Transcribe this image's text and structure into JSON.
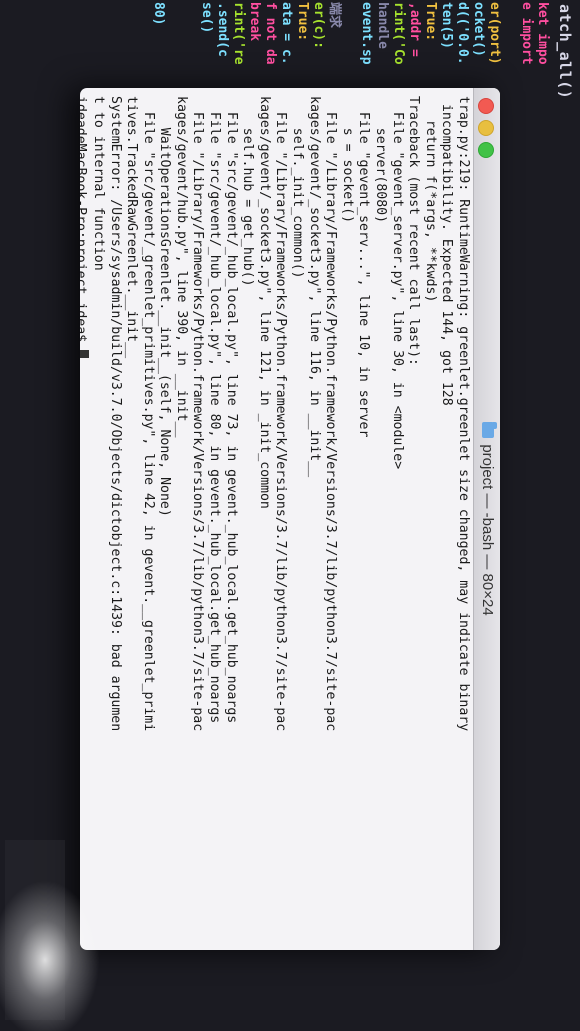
{
  "background_editor": {
    "top_text": "atch_all()",
    "lines": [
      {
        "text": "ket impo",
        "color": "#ff4fa0"
      },
      {
        "text": "e import",
        "color": "#ff4fa0"
      },
      {
        "text": "",
        "color": "#ffffff"
      },
      {
        "text": "er(port)",
        "color": "#f0c040"
      },
      {
        "text": "ocket()",
        "color": "#7de0ff"
      },
      {
        "text": "d(('0.0.",
        "color": "#7de0ff"
      },
      {
        "text": "ten(5)",
        "color": "#7de0ff"
      },
      {
        "text": " True:",
        "color": "#f0c040"
      },
      {
        "text": " ,addr =",
        "color": "#ff4fa0"
      },
      {
        "text": "rint('Co",
        "color": "#a6e22e"
      },
      {
        "text": " handle",
        "color": "#8888aa"
      },
      {
        "text": "event.sp",
        "color": "#7de0ff"
      },
      {
        "text": "",
        "color": "#ffffff"
      },
      {
        "text": "端求",
        "color": "#8888aa"
      },
      {
        "text": "er(c):",
        "color": "#a6e22e"
      },
      {
        "text": " True:",
        "color": "#f0c040"
      },
      {
        "text": "ata = c.",
        "color": "#7de0ff"
      },
      {
        "text": "f not da",
        "color": "#ff4fa0"
      },
      {
        "text": "   break",
        "color": "#ff4fa0"
      },
      {
        "text": "rint('re",
        "color": "#a6e22e"
      },
      {
        "text": ".send(c",
        "color": "#7de0ff"
      },
      {
        "text": "se()",
        "color": "#7de0ff"
      },
      {
        "text": "",
        "color": "#ffffff"
      },
      {
        "text": "",
        "color": "#ffffff"
      },
      {
        "text": "80)",
        "color": "#7de0ff"
      }
    ]
  },
  "terminal": {
    "title": "project — -bash — 80×24",
    "lines": [
      "trap.py:219: RuntimeWarning: greenlet.greenlet size changed, may indicate binary",
      " incompatibility. Expected 144, got 128",
      "   return f(*args, **kwds)",
      "Traceback (most recent call last):",
      "  File \"gevent_server.py\", line 30, in <module>",
      "    server(8080)",
      "  File \"gevent_serv...\", line 10, in server",
      "    s = socket()",
      "  File \"/Library/Frameworks/Python.framework/Versions/3.7/lib/python3.7/site-pac",
      "kages/gevent/_socket3.py\", line 116, in __init__",
      "    self._init_common()",
      "  File \"/Library/Frameworks/Python.framework/Versions/3.7/lib/python3.7/site-pac",
      "kages/gevent/_socket3.py\", line 121, in _init_common",
      "    self.hub = get_hub()",
      "  File \"src/gevent/_hub_local.py\", line 73, in gevent._hub_local.get_hub_noargs",
      "  File \"src/gevent/_hub_local.py\", line 80, in gevent._hub_local.get_hub_noargs",
      "  File \"/Library/Frameworks/Python.framework/Versions/3.7/lib/python3.7/site-pac",
      "kages/gevent/hub.py\", line 390, in __init__",
      "    WaitOperationsGreenlet.__init__(self, None, None)",
      "  File \"src/gevent/_greenlet_primitives.py\", line 42, in gevent.__greenlet_primi",
      "tives.TrackedRawGreenlet.__init__",
      "SystemError: /Users/sysadmin/build/v3.7.0/Objects/dictobject.c:1439: bad argumen",
      "t to internal function",
      "ideadeMacBook-Pro:project idea$ "
    ]
  }
}
